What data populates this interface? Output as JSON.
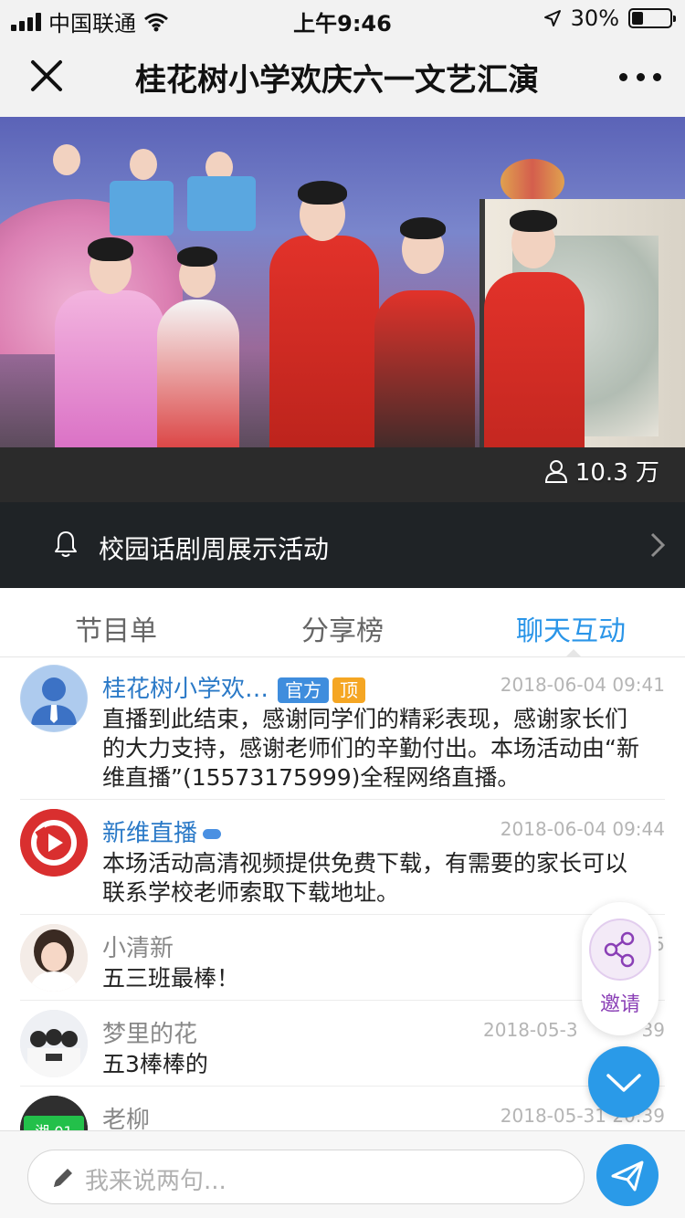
{
  "status_bar": {
    "carrier": "中国联通",
    "time": "上午9:46",
    "battery": "30%",
    "battery_level": 0.3
  },
  "nav": {
    "title": "桂花树小学欢庆六一文艺汇演"
  },
  "video": {
    "viewers": "10.3 万"
  },
  "notice": {
    "text": "校园话剧周展示活动"
  },
  "tabs": [
    {
      "label": "节目单"
    },
    {
      "label": "分享榜"
    },
    {
      "label": "聊天互动"
    }
  ],
  "active_tab": "聊天互动",
  "messages": [
    {
      "name": "桂花树小学欢…",
      "badges": [
        "官方",
        "顶"
      ],
      "time": "2018-06-04 09:41",
      "lines": [
        "直播到此结束，感谢同学们的精彩表现，感谢家长们",
        "的大力支持，感谢老师们的辛勤付出。本场活动由“新",
        "维直播”(15573175999)全程网络直播。"
      ]
    },
    {
      "name": "新维直播",
      "time": "2018-06-04 09:44",
      "lines": [
        "本场活动高清视频提供免费下载，有需要的家长可以",
        "联系学校老师索取下载地址。"
      ]
    },
    {
      "name": "小清新",
      "time": "2018-05",
      "lines": [
        "五三班最棒！"
      ]
    },
    {
      "name": "梦里的花",
      "time": "2018-05-3",
      "time_tail": "39",
      "lines": [
        "五3棒棒的"
      ]
    },
    {
      "name": "老柳",
      "time": "2018-05-31 20:39",
      "avatar_text": "湘 01"
    }
  ],
  "invite": {
    "label": "邀请"
  },
  "input": {
    "placeholder": "我来说两句..."
  },
  "colors": {
    "accent": "#2a9ae8",
    "official_badge": "#3f8ddd",
    "top_badge": "#f5a623",
    "invite_purple": "#8a3fb6",
    "notice_bg": "#1f2326"
  }
}
